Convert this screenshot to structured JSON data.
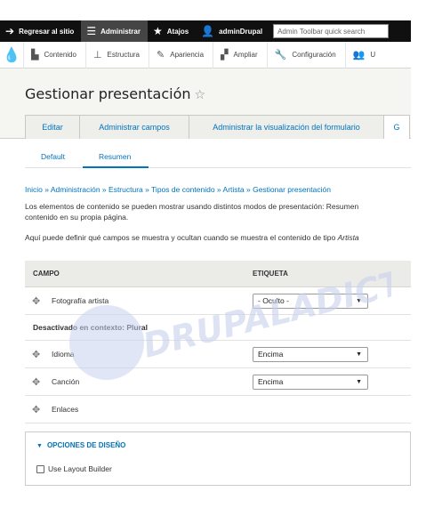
{
  "toolbar": {
    "back": "Regresar al sitio",
    "admin": "Administrar",
    "shortcuts": "Atajos",
    "user": "adminDrupal",
    "search_placeholder": "Admin Toolbar quick search"
  },
  "tray": {
    "items": [
      "Contenido",
      "Estructura",
      "Apariencia",
      "Ampliar",
      "Configuración",
      "U"
    ]
  },
  "page": {
    "title": "Gestionar presentación",
    "star": "☆"
  },
  "tabs": [
    "Editar",
    "Administrar campos",
    "Administrar la visualización del formulario",
    "G"
  ],
  "subtabs": [
    "Default",
    "Resumen"
  ],
  "breadcrumb": "Inicio » Administración » Estructura » Tipos de contenido » Artista » Gestionar presentación",
  "description": {
    "line1": "Los elementos de contenido se pueden mostrar usando distintos modos de presentación: Resumen",
    "line2": "contenido en su propia página.",
    "line3_prefix": "Aquí puede definir qué campos se muestra y ocultan cuando se muestra el contenido de tipo ",
    "line3_em": "Artista"
  },
  "table": {
    "col_field": "CAMPO",
    "col_label": "ETIQUETA",
    "rows": [
      {
        "name": "Fotografía artista",
        "label": "- Oculto -"
      },
      {
        "region": "Desactivado en contexto: Plural"
      },
      {
        "name": "Idioma",
        "label": "Encima"
      },
      {
        "name": "Canción",
        "label": "Encima"
      },
      {
        "name": "Enlaces"
      }
    ]
  },
  "layout_options": {
    "summary": "OPCIONES DE DISEÑO",
    "checkbox_label": "Use Layout Builder"
  },
  "watermark": "DRUPALADICTO",
  "colors": {
    "link": "#0074bd",
    "toolbar": "#101010"
  }
}
